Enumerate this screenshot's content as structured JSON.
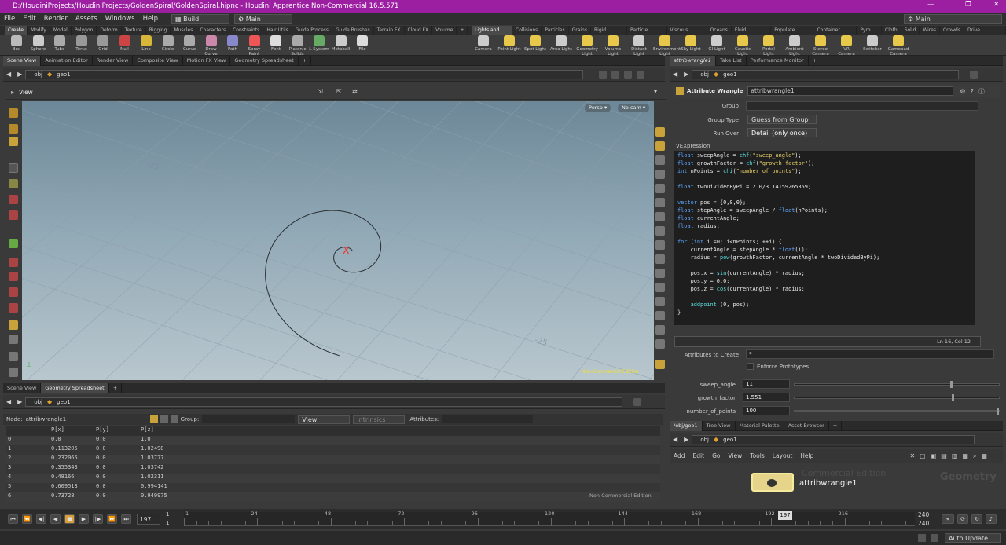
{
  "titlebar": {
    "title": "D:/HoudiniProjects/HoudiniProjects/GoldenSpiral/GoldenSpiral.hipnc - Houdini Apprentice Non-Commercial 16.5.571"
  },
  "menubar": {
    "items": [
      "File",
      "Edit",
      "Render",
      "Assets",
      "Windows",
      "Help"
    ],
    "build_label": "Build",
    "desktop": "Main",
    "right_desktop": "Main"
  },
  "shelf_tabs_left": [
    "Create",
    "Modify",
    "Model",
    "Polygon",
    "Deform",
    "Texture",
    "Rigging",
    "Muscles",
    "Characters",
    "Constraints",
    "Hair Utils",
    "Guide Process",
    "Guide Brushes",
    "Terrain FX",
    "Cloud FX",
    "Volume"
  ],
  "shelf_tabs_right": [
    "Lights and C...",
    "Collisions",
    "Particles",
    "Grains",
    "Rigid Bodies",
    "Particle Fluids",
    "Viscous Fluids",
    "Oceans",
    "Fluid Contai...",
    "Populate Con...",
    "Container Tools",
    "Pyro FX",
    "Cloth",
    "Solid",
    "Wires",
    "Crowds",
    "Drive Simula..."
  ],
  "shelf_tools_left": [
    "Box",
    "Sphere",
    "Tube",
    "Torus",
    "Grid",
    "Null",
    "Line",
    "Circle",
    "Curve",
    "Draw Curve",
    "Path",
    "Spray Paint",
    "Font",
    "Platonic Solids",
    "L-System",
    "Metaball",
    "File"
  ],
  "shelf_tools_right": [
    "Camera",
    "Point Light",
    "Spot Light",
    "Area Light",
    "Geometry Light",
    "Volume Light",
    "Distant Light",
    "Environment Light",
    "Sky Light",
    "GI Light",
    "Caustic Light",
    "Portal Light",
    "Ambient Light",
    "Stereo Camera",
    "VR Camera",
    "Switcher",
    "Gamepad Camera"
  ],
  "left_tabs": [
    "Scene View",
    "Animation Editor",
    "Render View",
    "Composite View",
    "Motion FX View",
    "Geometry Spreadsheet"
  ],
  "right_tabs": [
    "attribwrangle1",
    "Take List",
    "Performance Monitor"
  ],
  "path": {
    "obj": "obj",
    "geo": "geo1"
  },
  "viewport": {
    "label": "View",
    "persp": "Persp",
    "cam": "No cam",
    "watermark": "Non-Commercial Edition",
    "grid_label_a": "-25",
    "grid_label_b": "-25"
  },
  "params": {
    "node_type": "Attribute Wrangle",
    "node_name": "attribwrangle1",
    "group_label": "Group",
    "group_type_label": "Group Type",
    "group_type_value": "Guess from Group",
    "run_over_label": "Run Over",
    "run_over_value": "Detail (only once)",
    "vex_label": "VEXpression",
    "cursor_pos": "Ln 16, Col 12",
    "attrs_create_label": "Attributes to Create",
    "attrs_create_value": "*",
    "enforce_label": "Enforce Prototypes",
    "sliders": [
      {
        "label": "sweep_angle",
        "value": "11",
        "fraction": 0.76
      },
      {
        "label": "growth_factor",
        "value": "1.551",
        "fraction": 0.77
      },
      {
        "label": "number_of_points",
        "value": "100",
        "fraction": 0.99
      }
    ]
  },
  "code_lines": [
    "float sweepAngle = chf(\"sweep_angle\");",
    "float growthFactor = chf(\"growth_factor\");",
    "int nPoints = chi(\"number_of_points\");",
    "",
    "float twoDividedByPi = 2.0/3.14159265359;",
    "",
    "vector pos = {0,0,0};",
    "float stepAngle = sweepAngle / float(nPoints);",
    "float currentAngle;",
    "float radius;",
    "",
    "for (int i =0; i<nPoints; ++i) {",
    "    currentAngle = stepAngle * float(i);",
    "    radius = pow(growthFactor, currentAngle * twoDividedByPi);",
    "",
    "    pos.x = sin(currentAngle) * radius;",
    "    pos.y = 0.0;",
    "    pos.z = cos(currentAngle) * radius;",
    "",
    "    addpoint (0, pos);",
    "}"
  ],
  "bottom_tabs": [
    "Scene View",
    "Geometry Spreadsheet"
  ],
  "spreadsheet": {
    "node_label": "Node:",
    "node_name": "attribwrangle1",
    "group_label": "Group:",
    "view_label": "View",
    "intrinsics_label": "Intrinsics",
    "attributes_label": "Attributes:",
    "headers": [
      "P[x]",
      "P[y]",
      "P[z]"
    ],
    "rows": [
      [
        "0",
        "0.0",
        "0.0",
        "1.0"
      ],
      [
        "1",
        "0.113205",
        "0.0",
        "1.02498"
      ],
      [
        "2",
        "0.232065",
        "0.0",
        "1.03777"
      ],
      [
        "3",
        "0.355343",
        "0.0",
        "1.03742"
      ],
      [
        "4",
        "0.48166",
        "0.0",
        "1.02311"
      ],
      [
        "5",
        "0.609513",
        "0.0",
        "0.994141"
      ],
      [
        "6",
        "0.73728",
        "0.0",
        "0.949975"
      ]
    ],
    "watermark": "Non-Commercial Edition"
  },
  "net_tabs": [
    "/obj/geo1",
    "Tree View",
    "Material Palette",
    "Asset Browser"
  ],
  "net_menu": [
    "Add",
    "Edit",
    "Go",
    "View",
    "Tools",
    "Layout",
    "Help"
  ],
  "net": {
    "node_label": "attribwrangle1",
    "edition": "Commercial Edition",
    "context": "Geometry"
  },
  "timeline": {
    "frame": "197",
    "start": "1",
    "start2": "1",
    "end": "240",
    "end2": "240",
    "ticks": [
      "1",
      "24",
      "48",
      "72",
      "96",
      "120",
      "144",
      "168",
      "192",
      "216"
    ],
    "current_marker": "197"
  },
  "status": {
    "auto_update": "Auto Update"
  }
}
